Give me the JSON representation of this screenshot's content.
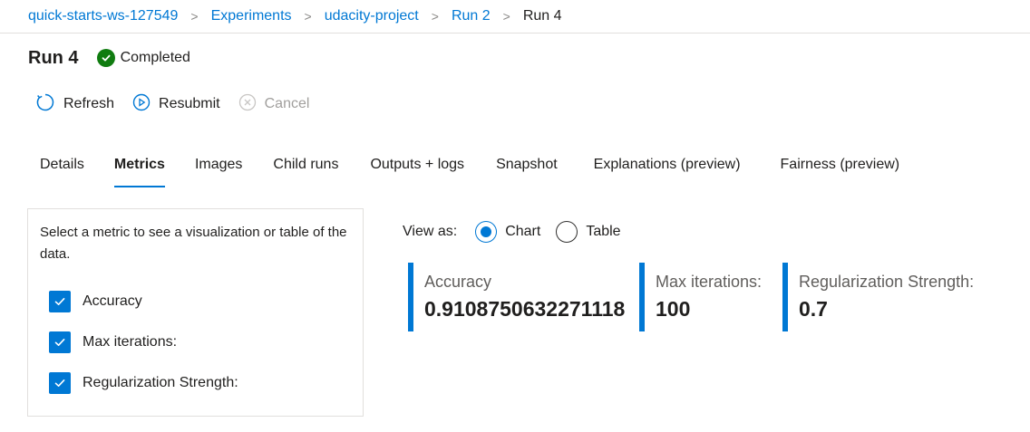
{
  "breadcrumb": {
    "items": [
      "quick-starts-ws-127549",
      "Experiments",
      "udacity-project",
      "Run 2",
      "Run 4"
    ]
  },
  "header": {
    "title": "Run 4",
    "status": "Completed",
    "status_color": "#107c10"
  },
  "toolbar": {
    "refresh_label": "Refresh",
    "resubmit_label": "Resubmit",
    "cancel_label": "Cancel"
  },
  "tabs": [
    {
      "label": "Details"
    },
    {
      "label": "Metrics",
      "active": true
    },
    {
      "label": "Images"
    },
    {
      "label": "Child runs"
    },
    {
      "label": "Outputs + logs"
    },
    {
      "label": "Snapshot"
    },
    {
      "label": "Explanations (preview)"
    },
    {
      "label": "Fairness (preview)"
    }
  ],
  "metric_panel": {
    "description": "Select a metric to see a visualization or table of the data.",
    "metrics": [
      {
        "label": "Accuracy",
        "checked": true
      },
      {
        "label": "Max iterations:",
        "checked": true
      },
      {
        "label": "Regularization Strength:",
        "checked": true
      }
    ]
  },
  "view_as": {
    "label": "View as:",
    "options": [
      "Chart",
      "Table"
    ],
    "selected": "Chart"
  },
  "cards": [
    {
      "label": "Accuracy",
      "value": "0.9108750632271118"
    },
    {
      "label": "Max iterations:",
      "value": "100"
    },
    {
      "label": "Regularization Strength:",
      "value": "0.7"
    }
  ],
  "colors": {
    "accent": "#0078d4",
    "success": "#107c10"
  }
}
